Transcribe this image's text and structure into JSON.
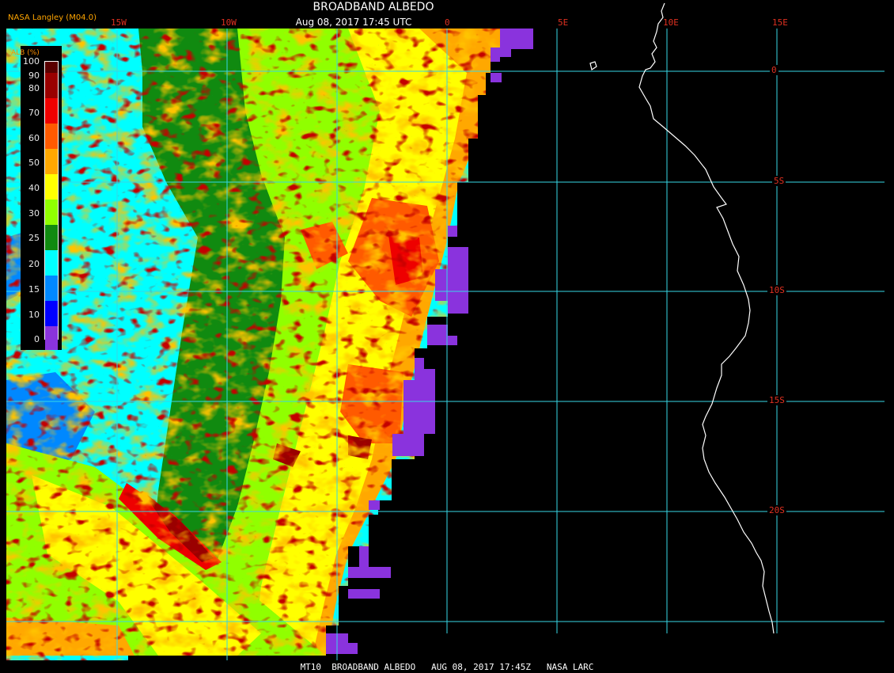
{
  "header": {
    "title": "BROADBAND ALBEDO",
    "subtitle": "Aug 08, 2017 17:45 UTC",
    "provider": "NASA Langley (M04.0)"
  },
  "legend": {
    "title": "ALB (%)",
    "levels": [
      {
        "label": "100",
        "color": "#5a0000"
      },
      {
        "label": "90",
        "color": "#9a0000"
      },
      {
        "label": "80",
        "color": "#ee0000"
      },
      {
        "label": "70",
        "color": "#ff5a00"
      },
      {
        "label": "60",
        "color": "#ffa800"
      },
      {
        "label": "50",
        "color": "#ffff00"
      },
      {
        "label": "40",
        "color": "#90ff00"
      },
      {
        "label": "30",
        "color": "#108a10"
      },
      {
        "label": "25",
        "color": "#00ffff"
      },
      {
        "label": "20",
        "color": "#0088ff"
      },
      {
        "label": "15",
        "color": "#0000ff"
      },
      {
        "label": "10",
        "color": "#8a33dd"
      },
      {
        "label": "0",
        "color": ""
      }
    ]
  },
  "grid": {
    "longitudes": [
      "15W",
      "10W",
      "0",
      "5E",
      "10E",
      "15E"
    ],
    "latitudes": [
      "0",
      "5S",
      "10S",
      "15S",
      "20S"
    ],
    "line_color": "#37d7e6",
    "label_color": "#e03020"
  },
  "footer": {
    "text": "MT10  BROADBAND ALBEDO   AUG 08, 2017 17:45Z   NASA LARC"
  }
}
